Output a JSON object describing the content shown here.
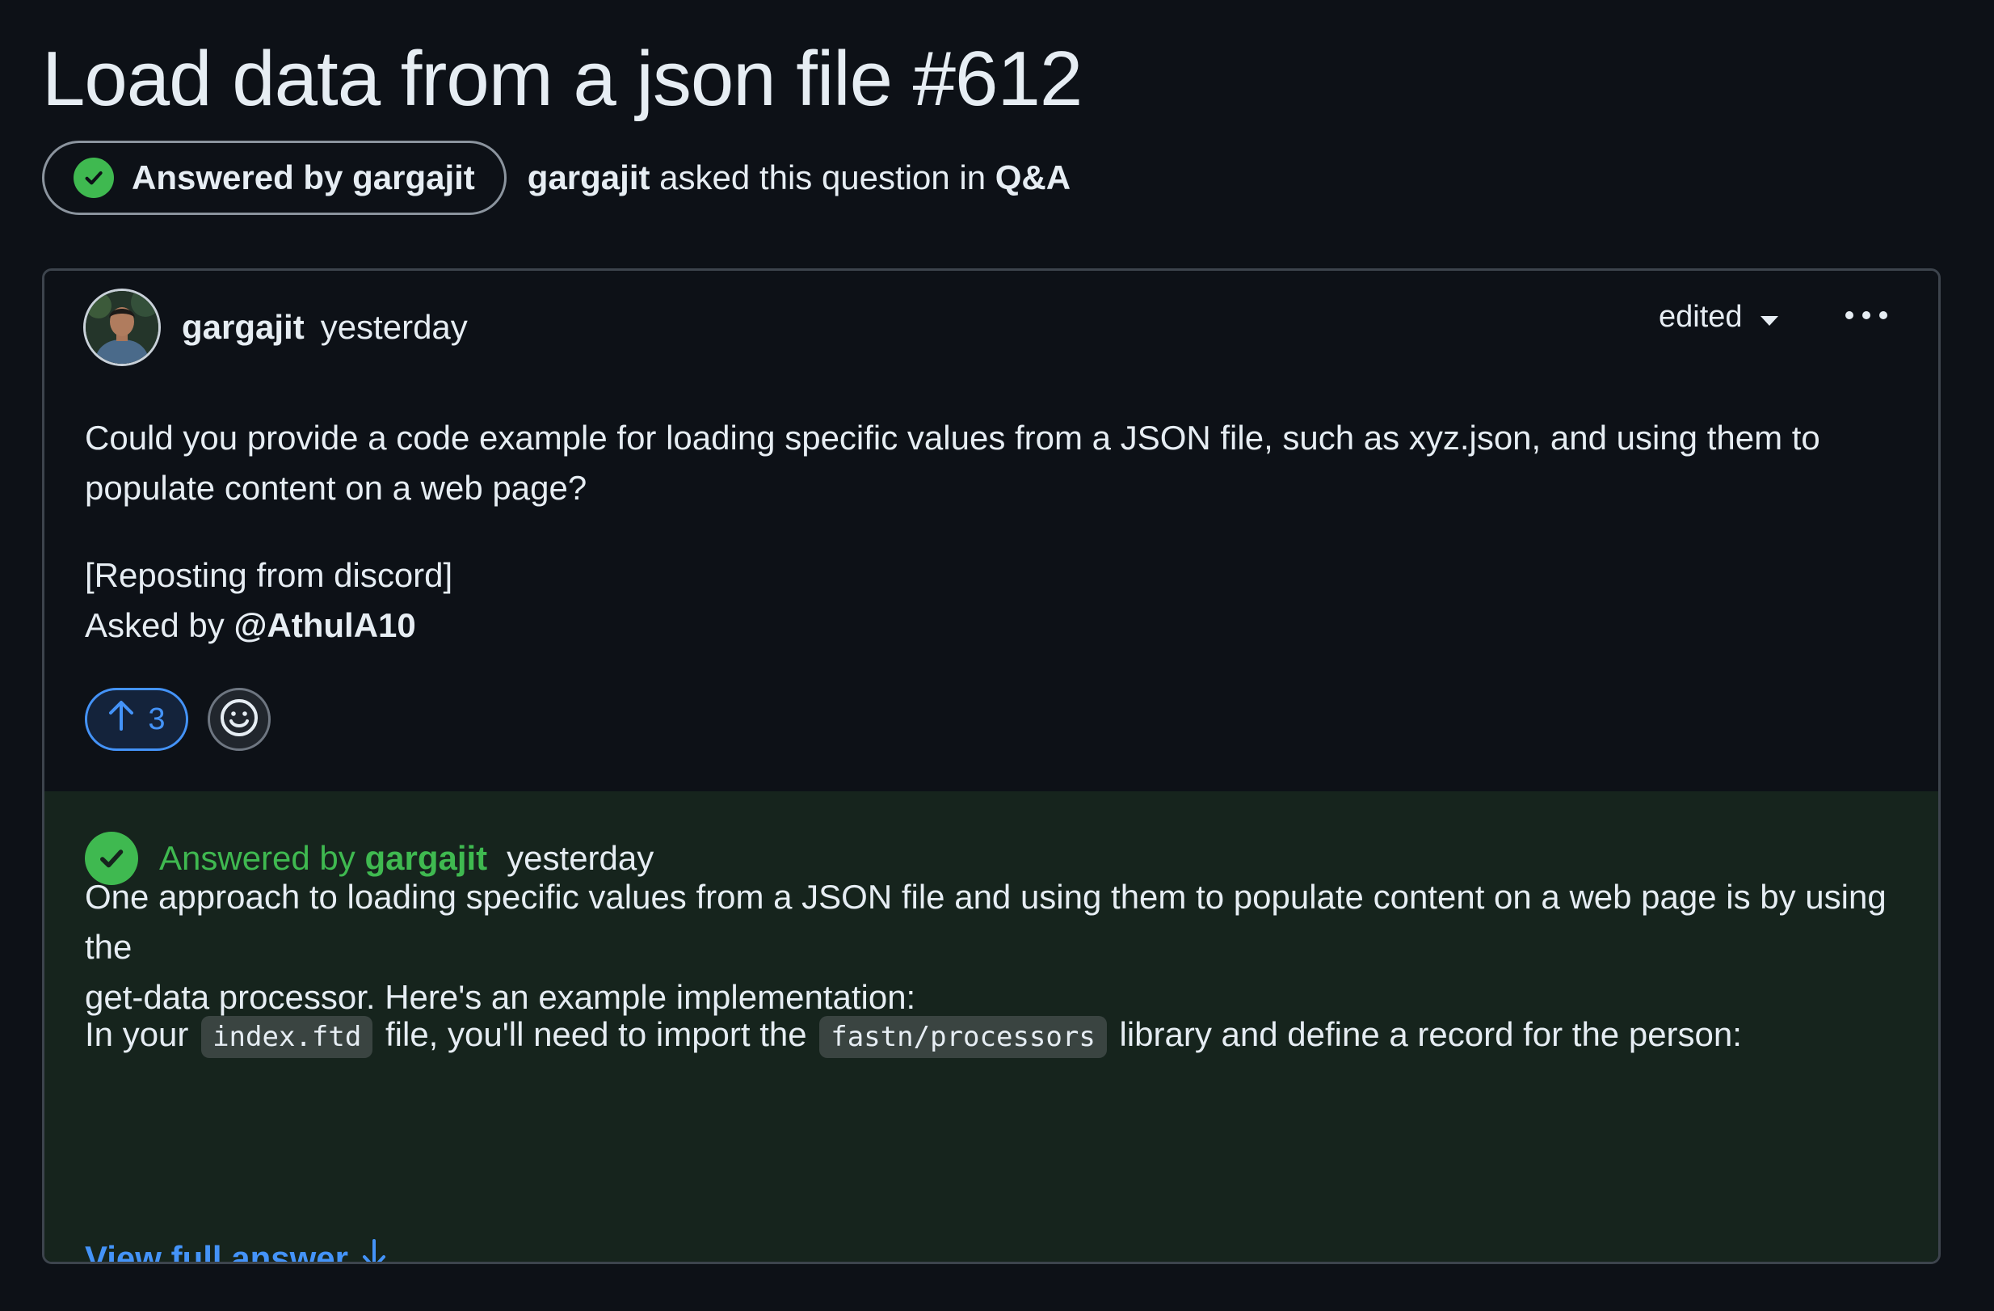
{
  "discussion": {
    "title": "Load data from a json file #612",
    "answered_label": "Answered by",
    "answered_by": "gargajit",
    "asker": "gargajit",
    "asked_text": "asked this question in",
    "category": "Q&A"
  },
  "post": {
    "author": "gargajit",
    "timestamp": "yesterday",
    "edited_label": "edited",
    "paragraph_1": "Could you provide a code example for loading specific values from a JSON file, such as xyz.json, and using them to",
    "paragraph_1_cont": "populate content on a web page?",
    "paragraph_2": "[Reposting from discord]",
    "asked_by_label": "Asked by",
    "asked_by_user": "@AthulA10",
    "upvotes": "3"
  },
  "answer": {
    "label": "Answered by",
    "author": "gargajit",
    "timestamp": "yesterday",
    "paragraph_1": "One approach to loading specific values from a JSON file and using them to populate content on a web page is by using the",
    "paragraph_1_cont": "get-data processor. Here's an example implementation:",
    "p2_before": "In your",
    "p2_code_1": "index.ftd",
    "p2_middle": "file, you'll need to import the",
    "p2_code_2": "fastn/processors",
    "p2_after": "library and define a record for the person:",
    "view_full": "View full answer"
  },
  "icons": {
    "check": "check-circle-icon",
    "caret": "triangle-down-icon",
    "more": "kebab-horizontal-icon",
    "upvote": "arrow-up-icon",
    "emoji": "smiley-icon",
    "view_full": "arrow-down-icon"
  },
  "colors": {
    "background": "#0d1117",
    "answer_background": "#16241d",
    "success": "#3fb950",
    "accent": "#4493f8",
    "border": "#3d444d"
  }
}
